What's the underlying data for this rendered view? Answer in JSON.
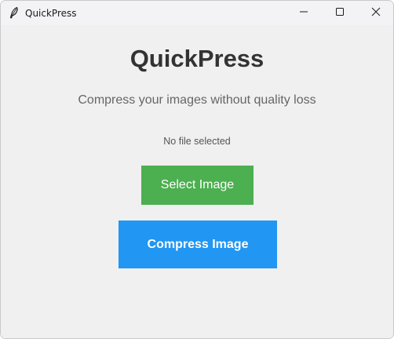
{
  "window": {
    "title": "QuickPress",
    "controls": {
      "minimize_icon": "minimize-icon",
      "maximize_icon": "maximize-icon",
      "close_icon": "close-icon"
    }
  },
  "main": {
    "heading": "QuickPress",
    "subtitle": "Compress your images without quality loss",
    "status": "No file selected",
    "select_button": "Select Image",
    "compress_button": "Compress Image"
  },
  "colors": {
    "background": "#f0f0f0",
    "heading": "#333333",
    "select_button": "#4caf50",
    "compress_button": "#2196f3"
  }
}
